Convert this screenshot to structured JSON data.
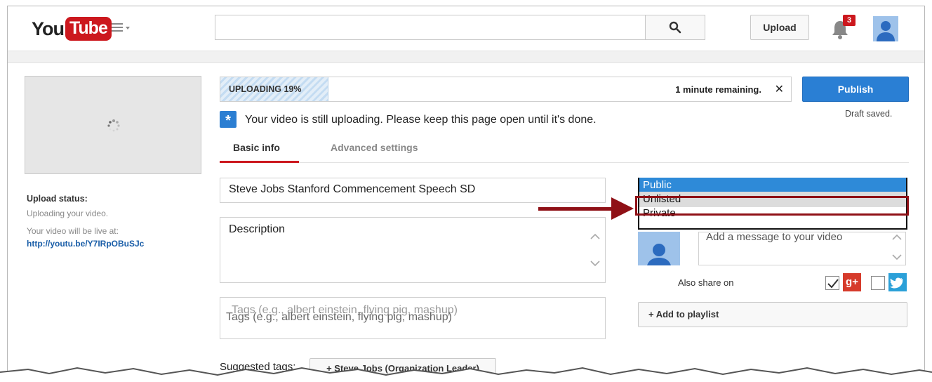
{
  "header": {
    "logo_you": "You",
    "logo_tube": "Tube",
    "search_placeholder": "",
    "upload_label": "Upload",
    "notification_count": "3"
  },
  "sidebar": {
    "upload_status_label": "Upload status:",
    "uploading_text": "Uploading your video.",
    "live_text": "Your video will be live at:",
    "video_link": "http://youtu.be/Y7IRpOBuSJc"
  },
  "progress": {
    "label": "UPLOADING 19%",
    "percent": 19,
    "remaining": "1 minute remaining.",
    "close_symbol": "✕"
  },
  "publish": {
    "label": "Publish",
    "draft_status": "Draft saved."
  },
  "notice": {
    "icon": "asterisk-icon",
    "text": "Your video is still uploading. Please keep this page open until it's done."
  },
  "tabs": [
    {
      "label": "Basic info",
      "active": true
    },
    {
      "label": "Advanced settings",
      "active": false
    }
  ],
  "form": {
    "title_value": "Steve Jobs Stanford Commencement Speech SD",
    "description_placeholder": "Description",
    "tags_placeholder": "Tags (e.g., albert einstein, flying pig, mashup)",
    "tags_value": "Tags (e.g., albert einstein, flying pig, mashup)",
    "suggested_label": "Suggested tags:",
    "suggested_tag": "+ Steve Jobs (Organization Leader)"
  },
  "privacy": {
    "options": [
      "Public",
      "Unlisted",
      "Private"
    ],
    "highlighted": "Unlisted"
  },
  "share": {
    "message_placeholder": "Add a message to your video",
    "also_share_label": "Also share on",
    "gplus_label": "g+",
    "gplus_checked": true,
    "twitter_checked": false
  },
  "playlist": {
    "label": "+ Add to playlist"
  },
  "colors": {
    "brand_red": "#cc181e",
    "publish_blue": "#2a7fd4",
    "annotation_red": "#8f1016"
  }
}
